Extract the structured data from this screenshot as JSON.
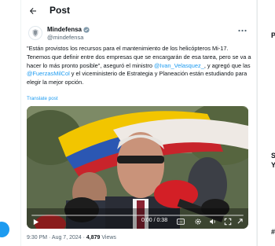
{
  "header": {
    "title": "Post"
  },
  "author": {
    "name": "Mindefensa",
    "handle": "@mindefensa"
  },
  "tweet": {
    "part1": "\"Están provistos los recursos para el mantenimiento de los helicópteros Mi-17. Tenemos que definir entre dos empresas que se encargarán de esa tarea, pero se va a hacer lo más pronto posible\", aseguró el ministro ",
    "mention1": "@Ivan_Velasquez_",
    "part2": ", y agregó que las ",
    "mention2": "@FuerzasMilCol",
    "part3": " y el viceministerio de Estrategia y Planeación están estudiando para elegir la mejor opción.",
    "translate_label": "Translate post"
  },
  "video": {
    "time": "0:00 / 0:38"
  },
  "meta": {
    "time": "9:30 PM · Aug 7, 2024 · ",
    "views": "4,879",
    "views_label": " Views"
  },
  "right_col": {
    "letter1": "P",
    "letter2": "S",
    "letter3": "Y",
    "letter4": "#"
  },
  "colors": {
    "accent": "#1d9bf0",
    "text": "#0f1419",
    "muted": "#536471"
  }
}
